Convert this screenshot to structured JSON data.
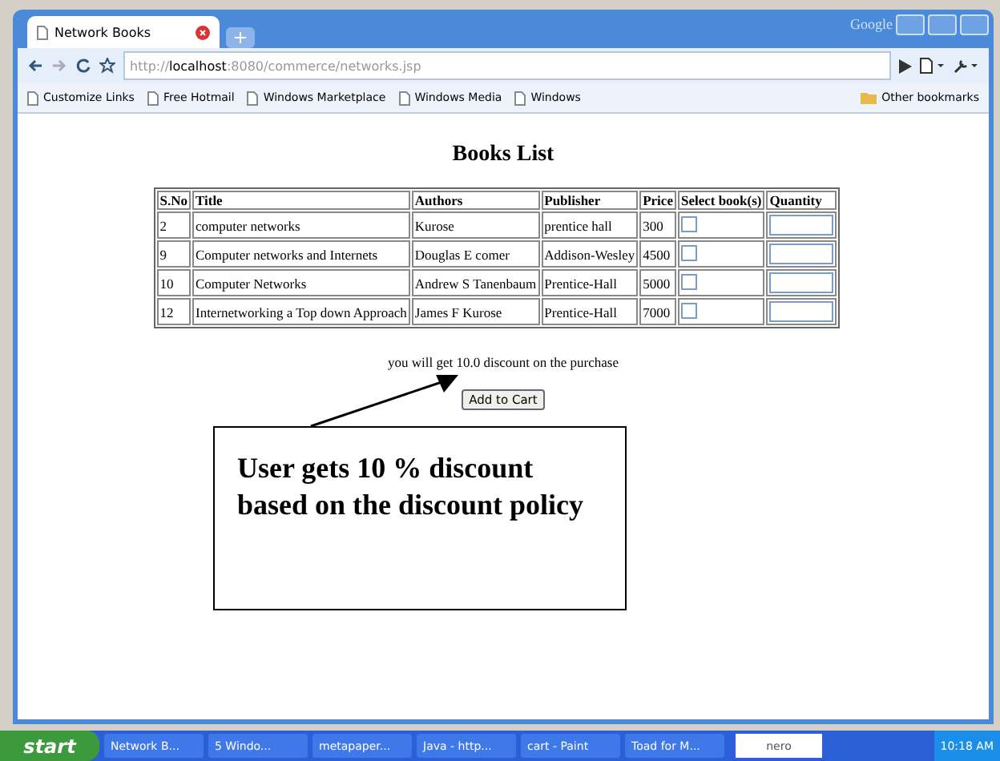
{
  "window": {
    "brand": "Google"
  },
  "tabs": [
    {
      "label": "Network Books",
      "selected": true
    }
  ],
  "address_bar": {
    "scheme": "http://",
    "host": "localhost",
    "rest": ":8080/commerce/networks.jsp"
  },
  "bookmarks": [
    "Customize Links",
    "Free Hotmail",
    "Windows Marketplace",
    "Windows Media",
    "Windows"
  ],
  "other_bookmarks": "Other bookmarks",
  "page": {
    "heading": "Books List",
    "table": {
      "columns": [
        "S.No",
        "Title",
        "Authors",
        "Publisher",
        "Price",
        "Select book(s)",
        "Quantity"
      ],
      "rows": [
        {
          "sno": "2",
          "title": "computer networks",
          "authors": "Kurose",
          "publisher": "prentice hall",
          "price": "300",
          "checked": false
        },
        {
          "sno": "9",
          "title": "Computer networks and Internets",
          "authors": "Douglas E comer",
          "publisher": "Addison-Wesley",
          "price": "4500",
          "checked": false
        },
        {
          "sno": "10",
          "title": "Computer Networks",
          "authors": "Andrew S Tanenbaum",
          "publisher": "Prentice-Hall",
          "price": "5000",
          "checked": false
        },
        {
          "sno": "12",
          "title": "Internetworking a Top down Approach",
          "authors": "James F Kurose",
          "publisher": "Prentice-Hall",
          "price": "7000",
          "checked": false
        }
      ]
    },
    "message": "you will get 10.0 discount on the purchase",
    "button": "Add to Cart"
  },
  "annotation": {
    "text": "User gets 10 % discount based on the discount policy"
  },
  "taskbar": {
    "start": "start",
    "items": [
      "Network B...",
      "5 Windo...",
      "metapaper...",
      "Java - http...",
      "cart - Paint",
      "Toad for M..."
    ],
    "tray_logo": "nero",
    "clock": "10:18 AM"
  }
}
